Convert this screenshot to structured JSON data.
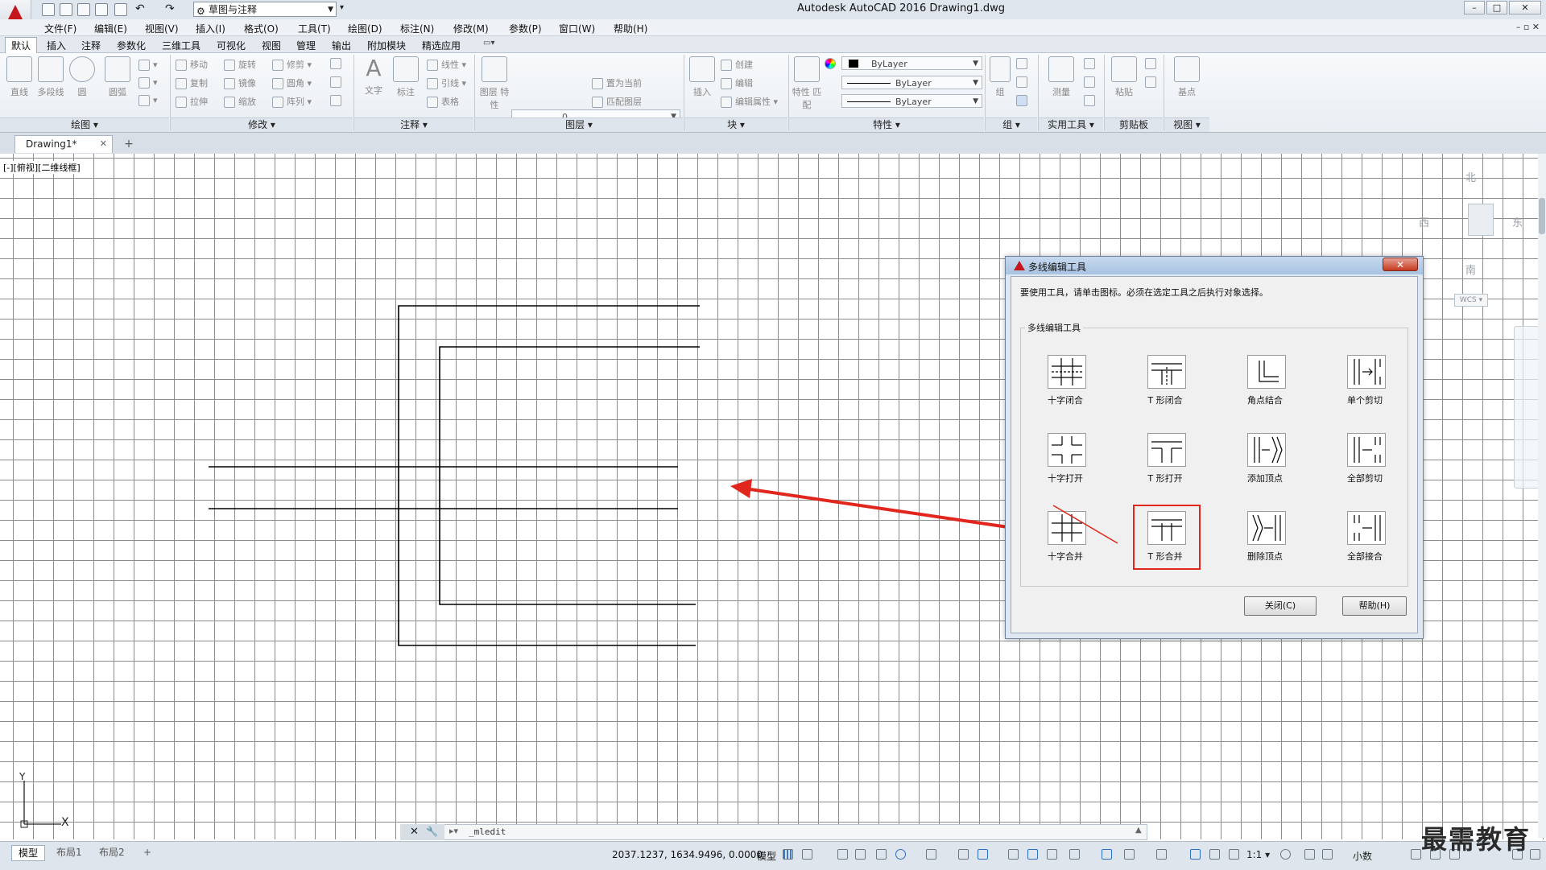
{
  "title_bar": {
    "workspace": "草图与注释",
    "title": "Autodesk AutoCAD 2016    Drawing1.dwg",
    "min_label": "–",
    "max_label": "□",
    "close_label": "✕"
  },
  "menu": {
    "items": [
      "文件(F)",
      "编辑(E)",
      "视图(V)",
      "插入(I)",
      "格式(O)",
      "工具(T)",
      "绘图(D)",
      "标注(N)",
      "修改(M)",
      "参数(P)",
      "窗口(W)",
      "帮助(H)"
    ],
    "right_controls": "– ▫ ✕"
  },
  "ribbon_tabs": [
    "默认",
    "插入",
    "注释",
    "参数化",
    "三维工具",
    "可视化",
    "视图",
    "管理",
    "输出",
    "附加模块",
    "精选应用"
  ],
  "ribbon": {
    "draw": {
      "title": "绘图 ▾",
      "line": "直线",
      "pline": "多段线",
      "circle": "圆",
      "arc": "圆弧"
    },
    "modify": {
      "title": "修改 ▾",
      "move": "移动",
      "rotate": "旋转",
      "trim": "修剪",
      "copy": "复制",
      "mirror": "镜像",
      "fillet": "圆角",
      "stretch": "拉伸",
      "scale": "缩放",
      "array": "阵列"
    },
    "annotation": {
      "title": "注释 ▾",
      "text": "文字",
      "dimension": "标注",
      "linear": "线性",
      "leader": "引线",
      "table": "表格"
    },
    "layers": {
      "title": "图层 ▾",
      "props": "图层\n特性",
      "current_layer": "0",
      "make_current": "置为当前",
      "match_layer": "匹配图层"
    },
    "block": {
      "title": "块 ▾",
      "insert": "插入",
      "create": "创建",
      "edit": "编辑",
      "edit_attr": "编辑属性 ▾"
    },
    "properties": {
      "title": "特性 ▾",
      "match": "特性\n匹配",
      "color": "ByLayer",
      "linetype": "ByLayer",
      "lineweight": "ByLayer"
    },
    "groups": {
      "title": "组 ▾",
      "group": "组"
    },
    "utilities": {
      "title": "实用工具 ▾",
      "measure": "测量"
    },
    "clipboard": {
      "title": "剪贴板",
      "paste": "粘贴"
    },
    "view": {
      "title": "视图 ▾",
      "base": "基点"
    }
  },
  "doc_tab": {
    "name": "Drawing1*",
    "close": "✕",
    "new": "+"
  },
  "viewport_label": "[-][俯视][二维线框]",
  "viewcube": {
    "north": "北",
    "south": "南",
    "east": "东",
    "west": "西",
    "wcs": "WCS ▾"
  },
  "ucs": {
    "x": "X",
    "y": "Y"
  },
  "command": {
    "prompt": "_mledit"
  },
  "status": {
    "layout_tabs": [
      "模型",
      "布局1",
      "布局2"
    ],
    "add_layout": "+",
    "coords": "2037.1237, 1634.9496, 0.0000",
    "model": "模型",
    "scale": "1:1 ▾",
    "units": "小数"
  },
  "watermark": "最需教育",
  "dialog": {
    "title": "多线编辑工具",
    "close_label": "✕",
    "instruction": "要使用工具，请单击图标。必须在选定工具之后执行对象选择。",
    "group_label": "多线编辑工具",
    "tools": [
      [
        "十字闭合",
        "T 形闭合",
        "角点结合",
        "单个剪切"
      ],
      [
        "十字打开",
        "T 形打开",
        "添加顶点",
        "全部剪切"
      ],
      [
        "十字合并",
        "T 形合并",
        "删除顶点",
        "全部接合"
      ]
    ],
    "close_button": "关闭(C)",
    "help_button": "帮助(H)"
  },
  "colors": {
    "annotation_red": "#e0261d",
    "app_red": "#c4161c"
  }
}
